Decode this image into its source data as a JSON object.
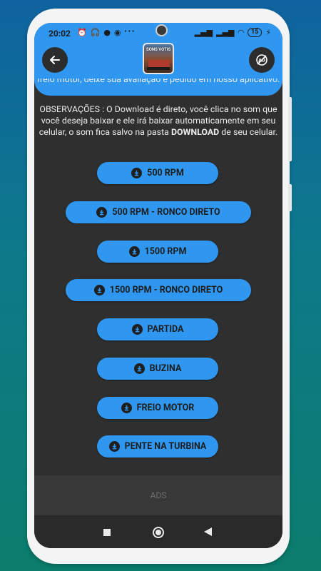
{
  "status_bar": {
    "time": "20:02",
    "dots": "···",
    "battery": "15"
  },
  "app_bar": {
    "logo_text": "SONS VOTIS"
  },
  "content": {
    "paragraph1": "freio motor, deixe sua avaliação e pedido em nosso aplicativo.",
    "paragraph2_prefix": "OBSERVAÇÕES : O Download é direto, você clica no som que você deseja baixar e ele irá baixar automaticamente em seu celular, o som fica salvo na pasta ",
    "paragraph2_bold": "DOWNLOAD",
    "paragraph2_suffix": " de seu celular."
  },
  "buttons": [
    {
      "label": "500 RPM"
    },
    {
      "label": "500 RPM - RONCO DIRETO"
    },
    {
      "label": "1500 RPM"
    },
    {
      "label": "1500 RPM - RONCO DIRETO"
    },
    {
      "label": "PARTIDA"
    },
    {
      "label": "BUZINA"
    },
    {
      "label": "FREIO MOTOR"
    },
    {
      "label": "PENTE NA TURBINA"
    }
  ],
  "ads": {
    "label": "ADS"
  },
  "colors": {
    "accent": "#2f97f0",
    "background": "#2f2f2f"
  }
}
